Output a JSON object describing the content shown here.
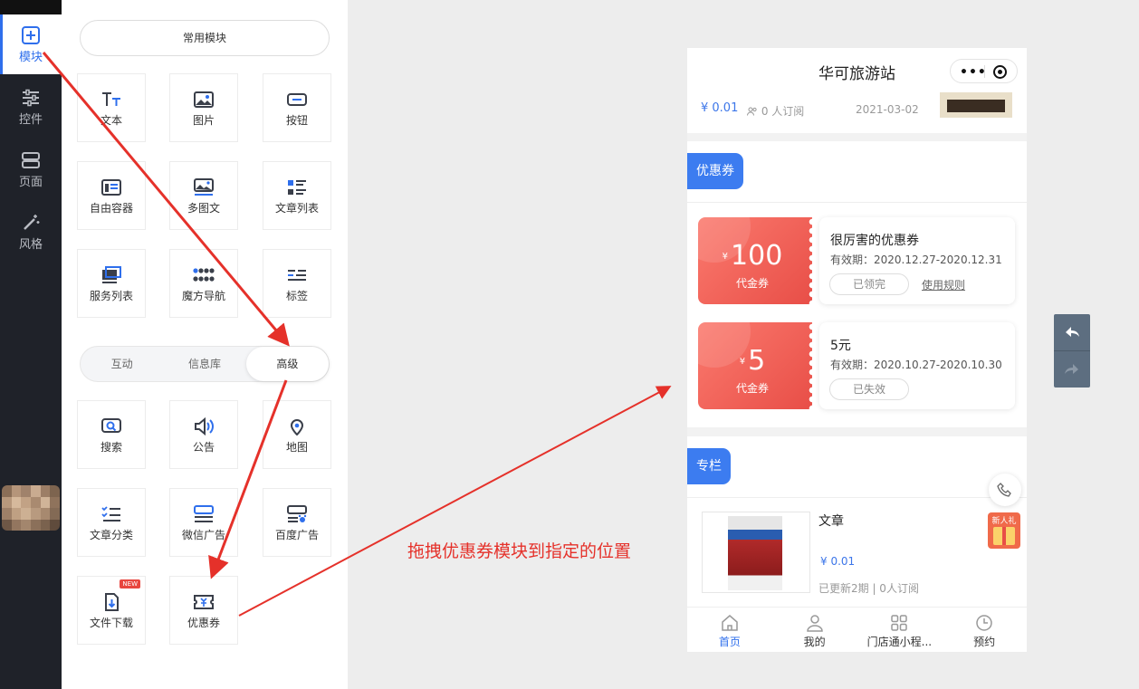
{
  "nav": {
    "items": [
      {
        "label": "模块",
        "icon": "plus-square-icon",
        "active": true
      },
      {
        "label": "控件",
        "icon": "sliders-icon",
        "active": false
      },
      {
        "label": "页面",
        "icon": "layers-icon",
        "active": false
      },
      {
        "label": "风格",
        "icon": "magic-wand-icon",
        "active": false
      }
    ]
  },
  "panel": {
    "common_label": "常用模块",
    "common_tiles": [
      {
        "label": "文本",
        "icon": "text-icon"
      },
      {
        "label": "图片",
        "icon": "image-icon"
      },
      {
        "label": "按钮",
        "icon": "button-icon"
      },
      {
        "label": "自由容器",
        "icon": "container-icon"
      },
      {
        "label": "多图文",
        "icon": "multi-image-icon"
      },
      {
        "label": "文章列表",
        "icon": "article-list-icon"
      },
      {
        "label": "服务列表",
        "icon": "service-list-icon"
      },
      {
        "label": "魔方导航",
        "icon": "cube-nav-icon"
      },
      {
        "label": "标签",
        "icon": "tag-icon"
      }
    ],
    "tabs": [
      {
        "label": "互动",
        "selected": false
      },
      {
        "label": "信息库",
        "selected": false
      },
      {
        "label": "高级",
        "selected": true
      }
    ],
    "advanced_tiles": [
      {
        "label": "搜索",
        "icon": "search-icon"
      },
      {
        "label": "公告",
        "icon": "speaker-icon"
      },
      {
        "label": "地图",
        "icon": "map-pin-icon"
      },
      {
        "label": "文章分类",
        "icon": "category-icon"
      },
      {
        "label": "微信广告",
        "icon": "wechat-ad-icon"
      },
      {
        "label": "百度广告",
        "icon": "baidu-ad-icon"
      },
      {
        "label": "文件下载",
        "icon": "file-download-icon",
        "badge": "NEW"
      },
      {
        "label": "优惠券",
        "icon": "coupon-icon"
      }
    ]
  },
  "phone": {
    "title": "华可旅游站",
    "capsule": {
      "more_icon": "more-dots-icon",
      "close_icon": "target-circle-icon"
    },
    "top_item": {
      "price": "¥ 0.01",
      "subscribers": "0 人订阅",
      "date": "2021-03-02"
    },
    "coupon_section": {
      "title": "优惠券",
      "coupons": [
        {
          "currency": "¥",
          "amount": "100",
          "type": "代金券",
          "name": "很厉害的优惠券",
          "validity": "有效期：2020.12.27-2020.12.31",
          "status": "已领完",
          "rule": "使用规则"
        },
        {
          "currency": "¥",
          "amount": "5",
          "type": "代金券",
          "name": "5元",
          "validity": "有效期：2020.10.27-2020.10.30",
          "status": "已失效",
          "rule": ""
        }
      ]
    },
    "column_section": {
      "title": "专栏",
      "item": {
        "title": "文章",
        "price": "¥ 0.01",
        "meta": "已更新2期 | 0人订阅"
      }
    },
    "gift_label": "新人礼",
    "tabbar": [
      {
        "label": "首页",
        "icon": "home-icon",
        "active": true
      },
      {
        "label": "我的",
        "icon": "user-icon",
        "active": false
      },
      {
        "label": "门店通小程...",
        "icon": "grid-icon",
        "active": false
      },
      {
        "label": "预约",
        "icon": "clock-icon",
        "active": false
      }
    ]
  },
  "instruction": "拖拽优惠券模块到指定的位置",
  "colors": {
    "accent": "#2f6fec",
    "coupon": "#e84e47",
    "annotation": "#e5312a"
  }
}
